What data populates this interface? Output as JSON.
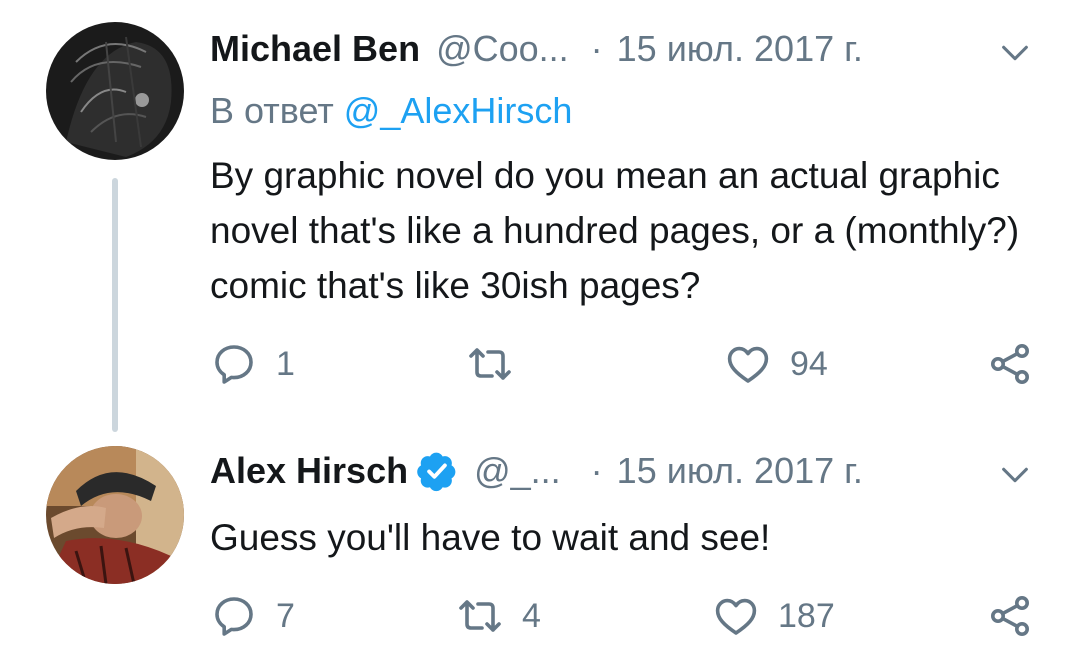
{
  "tweets": [
    {
      "name": "Michael Ben",
      "handle": "@Coo...",
      "separator": "·",
      "date": "15 июл. 2017 г.",
      "reply_prefix": "В ответ ",
      "reply_handle": "@_AlexHirsch",
      "text": "By graphic novel do you mean an actual graphic novel that's like a hundred pages, or a (monthly?) comic that's like 30ish pages?",
      "replies": "1",
      "retweets": "",
      "likes": "94"
    },
    {
      "name": "Alex Hirsch",
      "handle": "@_...",
      "separator": "·",
      "date": "15 июл. 2017 г.",
      "verified": true,
      "text": "Guess you'll have to wait and see!",
      "replies": "7",
      "retweets": "4",
      "likes": "187"
    }
  ],
  "colors": {
    "secondary": "#657786",
    "link": "#1da1f2",
    "verified": "#1da1f2",
    "thread_line": "#ccd6dd"
  },
  "icons": [
    "reply-icon",
    "retweet-icon",
    "like-icon",
    "share-icon",
    "chevron-down-icon",
    "verified-icon"
  ]
}
